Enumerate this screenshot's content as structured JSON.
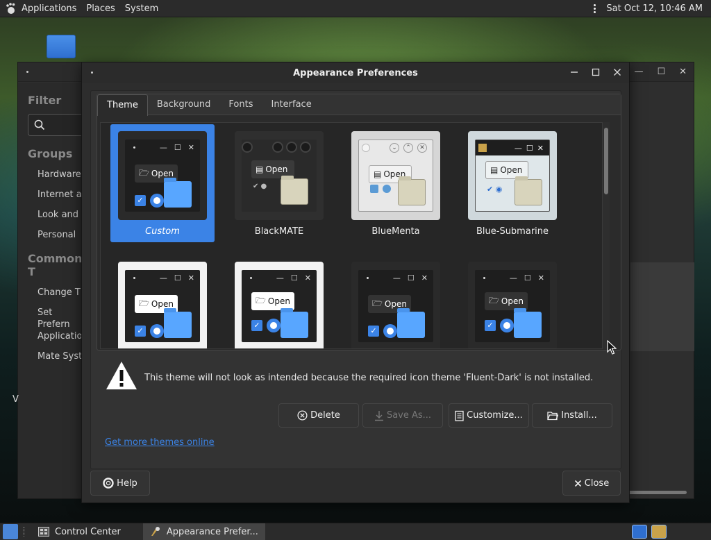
{
  "top_panel": {
    "menus": [
      "Applications",
      "Places",
      "System"
    ],
    "clock": "Sat Oct 12, 10:46 AM"
  },
  "bg_window": {
    "filter_heading": "Filter",
    "groups_heading": "Groups",
    "groups": [
      "Hardware",
      "Internet ar",
      "Look and F",
      "Personal"
    ],
    "common_heading": "Common T",
    "common": [
      "Change Th",
      "Set Prefern Application",
      "Mate Syste"
    ],
    "edge_v": "V"
  },
  "dialog": {
    "title": "Appearance Preferences",
    "tabs": [
      "Theme",
      "Background",
      "Fonts",
      "Interface"
    ],
    "active_tab": "Theme",
    "themes": [
      {
        "name": "Custom",
        "selected": true
      },
      {
        "name": "BlackMATE",
        "selected": false
      },
      {
        "name": "BlueMenta",
        "selected": false
      },
      {
        "name": "Blue-Submarine",
        "selected": false
      },
      {
        "name": "",
        "selected": false
      },
      {
        "name": "",
        "selected": false
      },
      {
        "name": "",
        "selected": false
      },
      {
        "name": "",
        "selected": false
      }
    ],
    "preview_open_label": "Open",
    "warning": "This theme will not look as intended because the required icon theme 'Fluent-Dark' is not installed.",
    "buttons": {
      "delete": "Delete",
      "save_as": "Save As...",
      "customize": "Customize...",
      "install": "Install..."
    },
    "more_themes_link": "Get more themes online",
    "help": "Help",
    "close": "Close"
  },
  "bottom_panel": {
    "tasks": [
      "Control Center",
      "Appearance Prefer..."
    ]
  },
  "colors": {
    "accent": "#3b83e6",
    "panel_bg": "#2b2b2b",
    "dialog_bg": "#2d2d2d"
  }
}
